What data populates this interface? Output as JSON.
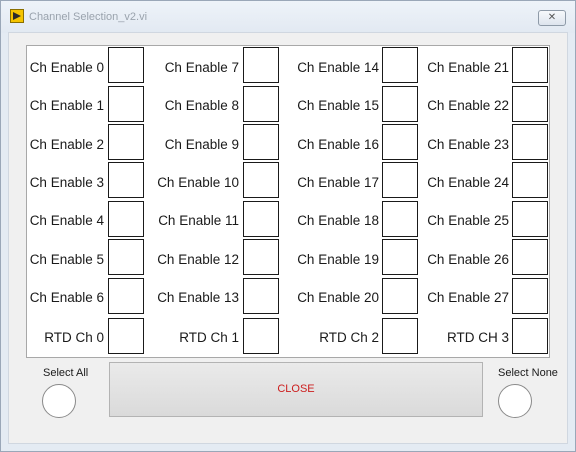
{
  "window": {
    "title": "Channel Selection_v2.vi",
    "close_glyph": "✕",
    "app_icon": "labview-run-arrow-icon",
    "app_icon_color": "#f5c400"
  },
  "channels": {
    "col0": [
      "Ch Enable 0",
      "Ch Enable 1",
      "Ch Enable 2",
      "Ch Enable 3",
      "Ch Enable 4",
      "Ch Enable 5",
      "Ch Enable 6",
      "RTD Ch 0"
    ],
    "col1": [
      "Ch Enable 7",
      "Ch Enable 8",
      "Ch Enable 9",
      "Ch Enable 10",
      "Ch Enable 11",
      "Ch Enable 12",
      "Ch Enable 13",
      "RTD Ch 1"
    ],
    "col2": [
      "Ch Enable 14",
      "Ch Enable 15",
      "Ch Enable 16",
      "Ch Enable 17",
      "Ch Enable 18",
      "Ch Enable 19",
      "Ch Enable 20",
      "RTD Ch 2"
    ],
    "col3": [
      "Ch Enable 21",
      "Ch Enable 22",
      "Ch Enable 23",
      "Ch Enable 24",
      "Ch Enable 25",
      "Ch Enable 26",
      "Ch Enable 27",
      "RTD CH 3"
    ]
  },
  "controls": {
    "select_all_label": "Select All",
    "select_none_label": "Select None",
    "close_label": "CLOSE",
    "close_label_color": "#cc1e1e"
  }
}
